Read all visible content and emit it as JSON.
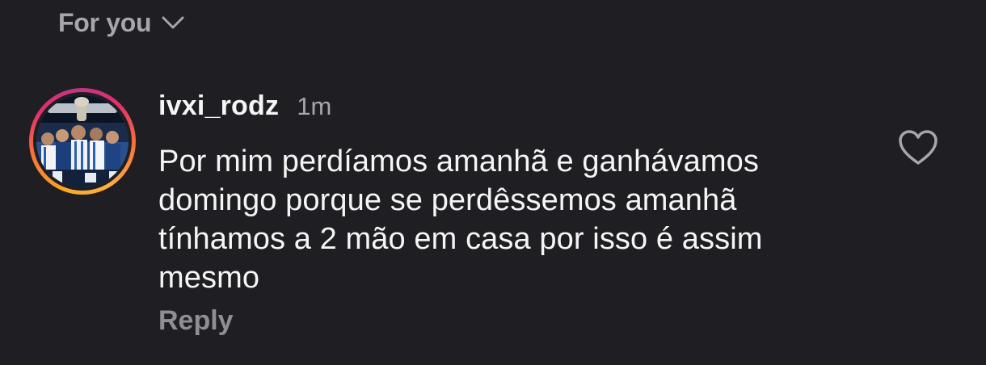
{
  "header": {
    "sort_label": "For you",
    "sort_icon": "chevron-down-icon"
  },
  "comment": {
    "username": "ivxi_rodz",
    "timestamp": "1m",
    "text": "Por mim perdíamos amanhã e ganhávamos domingo porque se perdêssemos amanhã tínhamos a 2 mão em casa por isso é assim mesmo",
    "reply_label": "Reply",
    "like_icon": "heart-outline-icon",
    "avatar_ring_colors": [
      "#fcaf45",
      "#f77737",
      "#e1306c",
      "#c13584"
    ]
  },
  "colors": {
    "background": "#1f1f23",
    "primary_text": "#f5f5f5",
    "secondary_text": "#a6a6ab"
  }
}
